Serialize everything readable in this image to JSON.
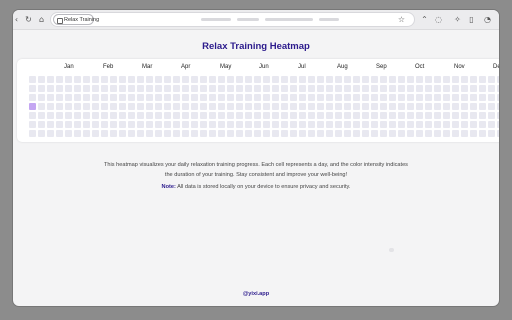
{
  "browser": {
    "tab_title": "Relax Training",
    "icons": [
      "back-icon",
      "reload-icon",
      "home-icon",
      "bookmark-star-icon",
      "extension-icon",
      "sync-icon",
      "puzzle-icon",
      "sidebar-icon",
      "profile-icon"
    ]
  },
  "page": {
    "title": "Relax Training Heatmap",
    "months": [
      "Jan",
      "Feb",
      "Mar",
      "Apr",
      "May",
      "Jun",
      "Jul",
      "Aug",
      "Sep",
      "Oct",
      "Nov",
      "De"
    ],
    "heatmap": {
      "rows": 7,
      "columns": 53,
      "active_cells": [
        {
          "row": 3,
          "col": 0,
          "level": 1
        }
      ]
    },
    "description": "This heatmap visualizes your daily relaxation training progress. Each cell represents a day, and the color intensity indicates the duration of your training. Stay consistent and improve your well-being!",
    "note_label": "Note:",
    "note_text": " All data is stored locally on your device to ensure privacy and security.",
    "footer": "@yixi.app"
  },
  "colors": {
    "accent": "#2b1a8c",
    "cell_empty": "#e8e8f0",
    "cell_active": "#c4a6f2"
  }
}
